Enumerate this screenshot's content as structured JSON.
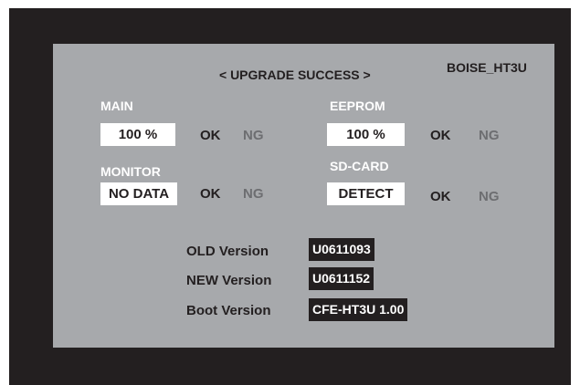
{
  "header": {
    "title": "< UPGRADE SUCCESS >",
    "model": "BOISE_HT3U"
  },
  "sections": {
    "main": {
      "label": "MAIN",
      "value": "100 %",
      "ok": "OK",
      "ng": "NG"
    },
    "eeprom": {
      "label": "EEPROM",
      "value": "100 %",
      "ok": "OK",
      "ng": "NG"
    },
    "monitor": {
      "label": "MONITOR",
      "value": "NO DATA",
      "ok": "OK",
      "ng": "NG"
    },
    "sdcard": {
      "label": "SD-CARD",
      "value": "DETECT",
      "ok": "OK",
      "ng": "NG"
    }
  },
  "versions": {
    "old": {
      "label": "OLD Version",
      "value": "U0611093"
    },
    "new": {
      "label": "NEW Version",
      "value": "U0611152"
    },
    "boot": {
      "label": "Boot Version",
      "value": "CFE-HT3U 1.00"
    }
  },
  "colors": {
    "frame": "#231f20",
    "panel": "#a7a9ac",
    "label": "#ffffff",
    "ok": "#231f20",
    "ng": "#6d6e71"
  }
}
